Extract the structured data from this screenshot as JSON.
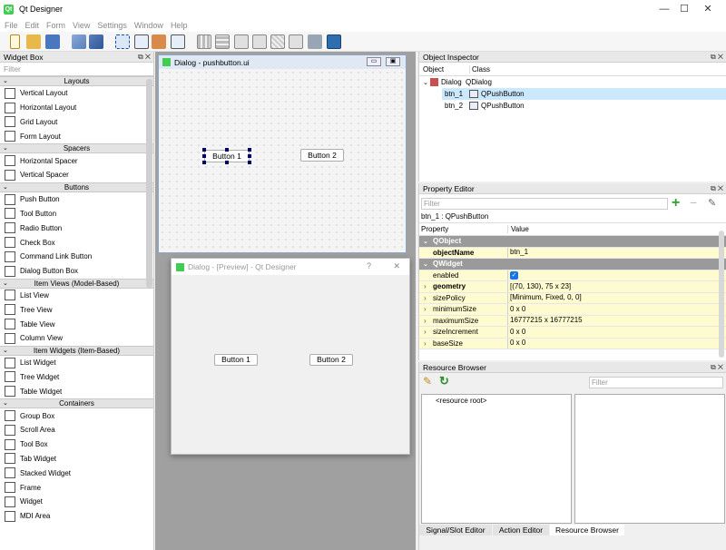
{
  "window": {
    "title": "Qt Designer",
    "minimize": "—",
    "maximize": "☐",
    "close": "✕"
  },
  "menu": [
    "File",
    "Edit",
    "Form",
    "View",
    "Settings",
    "Window",
    "Help"
  ],
  "widget_box": {
    "title": "Widget Box",
    "filter_placeholder": "Filter",
    "categories": [
      {
        "name": "Layouts",
        "items": [
          "Vertical Layout",
          "Horizontal Layout",
          "Grid Layout",
          "Form Layout"
        ]
      },
      {
        "name": "Spacers",
        "items": [
          "Horizontal Spacer",
          "Vertical Spacer"
        ]
      },
      {
        "name": "Buttons",
        "items": [
          "Push Button",
          "Tool Button",
          "Radio Button",
          "Check Box",
          "Command Link Button",
          "Dialog Button Box"
        ]
      },
      {
        "name": "Item Views (Model-Based)",
        "items": [
          "List View",
          "Tree View",
          "Table View",
          "Column View"
        ]
      },
      {
        "name": "Item Widgets (Item-Based)",
        "items": [
          "List Widget",
          "Tree Widget",
          "Table Widget"
        ]
      },
      {
        "name": "Containers",
        "items": [
          "Group Box",
          "Scroll Area",
          "Tool Box",
          "Tab Widget",
          "Stacked Widget",
          "Frame",
          "Widget",
          "MDI Area"
        ]
      }
    ]
  },
  "form": {
    "title": "Dialog - pushbutton.ui",
    "btn1": "Button 1",
    "btn2": "Button 2"
  },
  "preview": {
    "title": "Dialog - [Preview] - Qt Designer",
    "help": "?",
    "close": "✕",
    "btn1": "Button 1",
    "btn2": "Button 2"
  },
  "object_inspector": {
    "title": "Object Inspector",
    "col_object": "Object",
    "col_class": "Class",
    "rows": [
      {
        "object": "Dialog",
        "class": "QDialog"
      },
      {
        "object": "btn_1",
        "class": "QPushButton"
      },
      {
        "object": "btn_2",
        "class": "QPushButton"
      }
    ]
  },
  "property_editor": {
    "title": "Property Editor",
    "filter_placeholder": "Filter",
    "context": "btn_1 : QPushButton",
    "col_property": "Property",
    "col_value": "Value",
    "group1": "QObject",
    "objectName_k": "objectName",
    "objectName_v": "btn_1",
    "group2": "QWidget",
    "rows": [
      {
        "k": "enabled",
        "v": ""
      },
      {
        "k": "geometry",
        "v": "[(70, 130), 75 x 23]"
      },
      {
        "k": "sizePolicy",
        "v": "[Minimum, Fixed, 0, 0]"
      },
      {
        "k": "minimumSize",
        "v": "0 x 0"
      },
      {
        "k": "maximumSize",
        "v": "16777215 x 16777215"
      },
      {
        "k": "sizeIncrement",
        "v": "0 x 0"
      },
      {
        "k": "baseSize",
        "v": "0 x 0"
      }
    ]
  },
  "resource_browser": {
    "title": "Resource Browser",
    "filter_placeholder": "Filter",
    "root": "<resource root>"
  },
  "tabs": [
    "Signal/Slot Editor",
    "Action Editor",
    "Resource Browser"
  ],
  "colors": {
    "selection": "#cce8ff",
    "group_header": "#9a9a9a",
    "yellow_row": "#fffbd0",
    "qt_green": "#41cd52"
  }
}
